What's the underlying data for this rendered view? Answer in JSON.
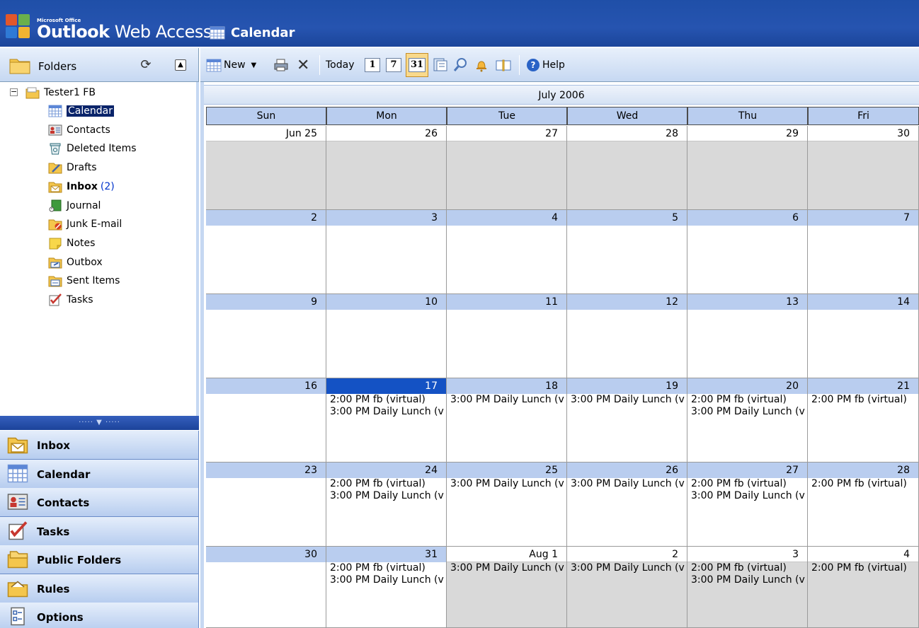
{
  "banner": {
    "brand_small": "Microsoft Office",
    "brand_bold": "Outlook",
    "brand_rest": " Web Access",
    "module_title": "Calendar"
  },
  "folders_pane": {
    "header_label": "Folders",
    "mailbox": "Tester1 FB",
    "items": [
      {
        "label": "Calendar",
        "icon": "calendar-icon",
        "selected": true
      },
      {
        "label": "Contacts",
        "icon": "contacts-icon"
      },
      {
        "label": "Deleted Items",
        "icon": "deleted-items-icon"
      },
      {
        "label": "Drafts",
        "icon": "drafts-icon"
      },
      {
        "label": "Inbox",
        "icon": "inbox-icon",
        "bold": true,
        "unread": "(2)"
      },
      {
        "label": "Journal",
        "icon": "journal-icon"
      },
      {
        "label": "Junk E-mail",
        "icon": "junk-email-icon"
      },
      {
        "label": "Notes",
        "icon": "notes-icon"
      },
      {
        "label": "Outbox",
        "icon": "outbox-icon"
      },
      {
        "label": "Sent Items",
        "icon": "sent-items-icon"
      },
      {
        "label": "Tasks",
        "icon": "tasks-icon"
      }
    ]
  },
  "nav": {
    "splitter_glyph": "····· ▼ ·····",
    "buttons": [
      {
        "label": "Inbox",
        "icon": "inbox-icon"
      },
      {
        "label": "Calendar",
        "icon": "calendar-icon"
      },
      {
        "label": "Contacts",
        "icon": "contacts-icon"
      },
      {
        "label": "Tasks",
        "icon": "tasks-icon"
      },
      {
        "label": "Public Folders",
        "icon": "public-folders-icon"
      },
      {
        "label": "Rules",
        "icon": "rules-icon"
      },
      {
        "label": "Options",
        "icon": "options-icon"
      }
    ]
  },
  "toolbar": {
    "new_label": "New",
    "today_label": "Today",
    "day_view_glyph": "1",
    "week_view_glyph": "7",
    "month_view_glyph": "31",
    "help_label": "Help"
  },
  "calendar": {
    "month_title": "July 2006",
    "weekdays": [
      "Sun",
      "Mon",
      "Tue",
      "Wed",
      "Thu",
      "Fri"
    ],
    "weeks": [
      {
        "days": [
          {
            "label": "Jun 25",
            "grey": true,
            "events": []
          },
          {
            "label": "26",
            "grey": true,
            "events": []
          },
          {
            "label": "27",
            "grey": true,
            "events": []
          },
          {
            "label": "28",
            "grey": true,
            "events": []
          },
          {
            "label": "29",
            "grey": true,
            "events": []
          },
          {
            "label": "30",
            "grey": true,
            "events": []
          }
        ]
      },
      {
        "days": [
          {
            "label": "2",
            "events": []
          },
          {
            "label": "3",
            "events": []
          },
          {
            "label": "4",
            "events": []
          },
          {
            "label": "5",
            "events": []
          },
          {
            "label": "6",
            "events": []
          },
          {
            "label": "7",
            "events": []
          }
        ]
      },
      {
        "days": [
          {
            "label": "9",
            "events": []
          },
          {
            "label": "10",
            "events": []
          },
          {
            "label": "11",
            "events": []
          },
          {
            "label": "12",
            "events": []
          },
          {
            "label": "13",
            "events": []
          },
          {
            "label": "14",
            "events": []
          }
        ]
      },
      {
        "days": [
          {
            "label": "16",
            "events": []
          },
          {
            "label": "17",
            "today": true,
            "events": [
              "2:00 PM fb (virtual)",
              "3:00 PM Daily Lunch (v"
            ]
          },
          {
            "label": "18",
            "events": [
              "3:00 PM Daily Lunch (v"
            ]
          },
          {
            "label": "19",
            "events": [
              "3:00 PM Daily Lunch (v"
            ]
          },
          {
            "label": "20",
            "events": [
              "2:00 PM fb (virtual)",
              "3:00 PM Daily Lunch (v"
            ]
          },
          {
            "label": "21",
            "events": [
              "2:00 PM fb (virtual)"
            ]
          }
        ]
      },
      {
        "days": [
          {
            "label": "23",
            "events": []
          },
          {
            "label": "24",
            "events": [
              "2:00 PM fb (virtual)",
              "3:00 PM Daily Lunch (v"
            ]
          },
          {
            "label": "25",
            "events": [
              "3:00 PM Daily Lunch (v"
            ]
          },
          {
            "label": "26",
            "events": [
              "3:00 PM Daily Lunch (v"
            ]
          },
          {
            "label": "27",
            "events": [
              "2:00 PM fb (virtual)",
              "3:00 PM Daily Lunch (v"
            ]
          },
          {
            "label": "28",
            "events": [
              "2:00 PM fb (virtual)"
            ]
          }
        ]
      },
      {
        "days": [
          {
            "label": "30",
            "events": []
          },
          {
            "label": "31",
            "events": [
              "2:00 PM fb (virtual)",
              "3:00 PM Daily Lunch (v"
            ]
          },
          {
            "label": "Aug 1",
            "grey": true,
            "events": [
              "3:00 PM Daily Lunch (v"
            ]
          },
          {
            "label": "2",
            "grey": true,
            "events": [
              "3:00 PM Daily Lunch (v"
            ]
          },
          {
            "label": "3",
            "grey": true,
            "events": [
              "2:00 PM fb (virtual)",
              "3:00 PM Daily Lunch (v"
            ]
          },
          {
            "label": "4",
            "grey": true,
            "events": [
              "2:00 PM fb (virtual)"
            ]
          }
        ]
      }
    ]
  },
  "colors": {
    "banner_blue": "#1f4fa8",
    "day_header_blue": "#b9cdef",
    "today_blue": "#1452c4",
    "selection_navy": "#0a246a"
  }
}
